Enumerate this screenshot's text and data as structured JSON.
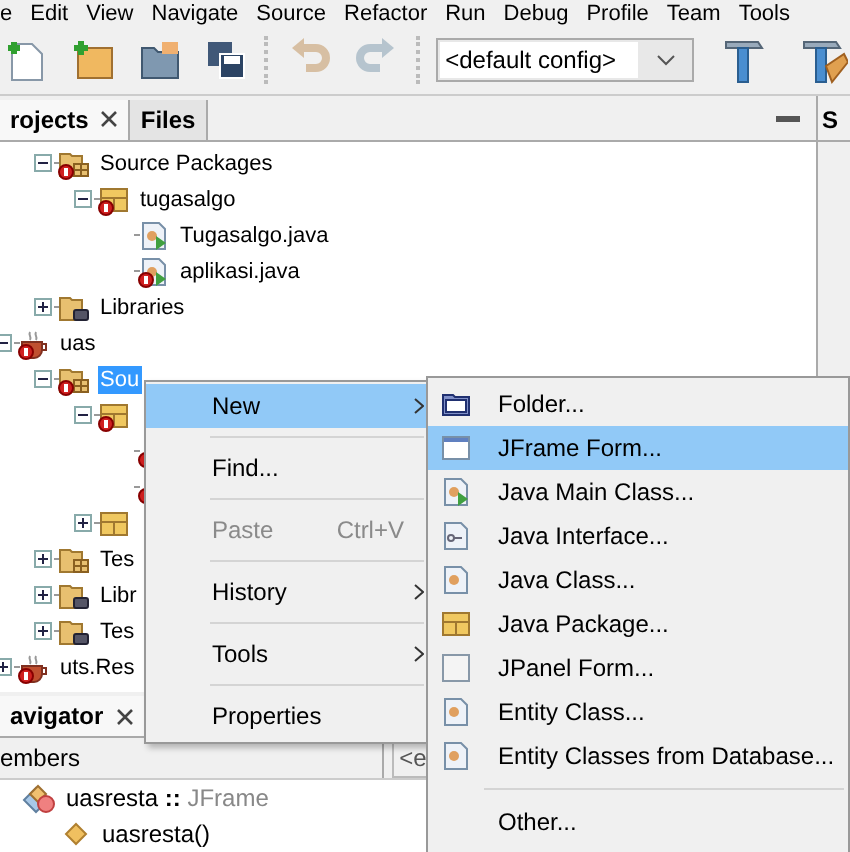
{
  "menu_bar": [
    "e",
    "Edit",
    "View",
    "Navigate",
    "Source",
    "Refactor",
    "Run",
    "Debug",
    "Profile",
    "Team",
    "Tools"
  ],
  "toolbar": {
    "buttons": [
      {
        "kind": "new-file",
        "disabled": false
      },
      {
        "kind": "new-project",
        "disabled": false
      },
      {
        "kind": "open-project",
        "disabled": false
      },
      {
        "kind": "save-all",
        "disabled": false
      },
      {
        "kind": "undo",
        "disabled": true
      },
      {
        "kind": "redo",
        "disabled": true
      }
    ],
    "config": "<default config>",
    "build_buttons": [
      {
        "kind": "build"
      },
      {
        "kind": "clean-build"
      }
    ]
  },
  "projects_panel": {
    "tabs": [
      {
        "label": "rojects",
        "selected": true,
        "closable": true
      },
      {
        "label": "Files",
        "selected": false,
        "closable": false
      }
    ],
    "tree": {
      "partial_children": [
        {
          "label": "Source Packages",
          "kind": "source-folder",
          "error": true,
          "expanded": true,
          "selected": false,
          "children": [
            {
              "label": "tugasalgo",
              "kind": "package",
              "error": true,
              "expanded": true,
              "selected": false,
              "children": [
                {
                  "label": "Tugasalgo.java",
                  "kind": "main-class",
                  "error": false,
                  "selected": false
                },
                {
                  "label": "aplikasi.java",
                  "kind": "main-class",
                  "error": true,
                  "selected": false
                }
              ]
            }
          ]
        },
        {
          "label": "Libraries",
          "kind": "library",
          "error": false,
          "expanded": false,
          "selected": false
        }
      ],
      "projects": [
        {
          "label": "uas",
          "kind": "project",
          "error": true,
          "expanded": true,
          "selected": false,
          "children": [
            {
              "label": "Sou",
              "kind": "source-folder",
              "error": true,
              "expanded": true,
              "selected": true,
              "children": [
                {
                  "kind": "package",
                  "error": true,
                  "expanded": true,
                  "children": [
                    {
                      "error": true
                    },
                    {
                      "error": true
                    }
                  ]
                },
                {
                  "kind": "package",
                  "error": false,
                  "expanded": false
                }
              ]
            },
            {
              "label": "Tes",
              "kind": "source-folder",
              "error": false,
              "expanded": false,
              "selected": false
            },
            {
              "label": "Libr",
              "kind": "library",
              "error": false,
              "expanded": false,
              "selected": false
            },
            {
              "label": "Tes",
              "kind": "library",
              "error": false,
              "expanded": false,
              "selected": false
            }
          ]
        },
        {
          "label": "uts.Res",
          "kind": "project",
          "error": true,
          "expanded": false,
          "selected": false
        }
      ]
    }
  },
  "side_tab": "S",
  "navigator": {
    "tab": "avigator",
    "filter": "embers",
    "filter_2": "<e",
    "nodes": [
      {
        "kind": "class",
        "name": "uasresta",
        "separator": "::",
        "type": "JFrame",
        "children": [
          {
            "kind": "constructor",
            "name": "uasresta()"
          }
        ]
      }
    ]
  },
  "context_menu": [
    {
      "kind": "item",
      "label": "New",
      "selected": true,
      "submenu": true,
      "disabled": false
    },
    {
      "kind": "separator"
    },
    {
      "kind": "item",
      "label": "Find...",
      "selected": false,
      "submenu": false,
      "disabled": false
    },
    {
      "kind": "separator"
    },
    {
      "kind": "item",
      "label": "Paste",
      "shortcut": "Ctrl+V",
      "selected": false,
      "submenu": false,
      "disabled": true
    },
    {
      "kind": "separator"
    },
    {
      "kind": "item",
      "label": "History",
      "selected": false,
      "submenu": true,
      "disabled": false
    },
    {
      "kind": "separator"
    },
    {
      "kind": "item",
      "label": "Tools",
      "selected": false,
      "submenu": true,
      "disabled": false
    },
    {
      "kind": "separator"
    },
    {
      "kind": "item",
      "label": "Properties",
      "selected": false,
      "submenu": false,
      "disabled": false
    }
  ],
  "new_submenu": [
    {
      "kind": "folder",
      "label": "Folder...",
      "selected": false
    },
    {
      "kind": "jframe",
      "label": "JFrame Form...",
      "selected": true
    },
    {
      "kind": "main-class",
      "label": "Java Main Class...",
      "selected": false
    },
    {
      "kind": "interface",
      "label": "Java Interface...",
      "selected": false
    },
    {
      "kind": "class",
      "label": "Java Class...",
      "selected": false
    },
    {
      "kind": "package",
      "label": "Java Package...",
      "selected": false
    },
    {
      "kind": "jpanel",
      "label": "JPanel Form...",
      "selected": false
    },
    {
      "kind": "class",
      "label": "Entity Class...",
      "selected": false
    },
    {
      "kind": "class",
      "label": "Entity Classes from Database...",
      "selected": false
    },
    {
      "kind": "separator"
    },
    {
      "kind": "other",
      "label": "Other...",
      "selected": false
    }
  ]
}
